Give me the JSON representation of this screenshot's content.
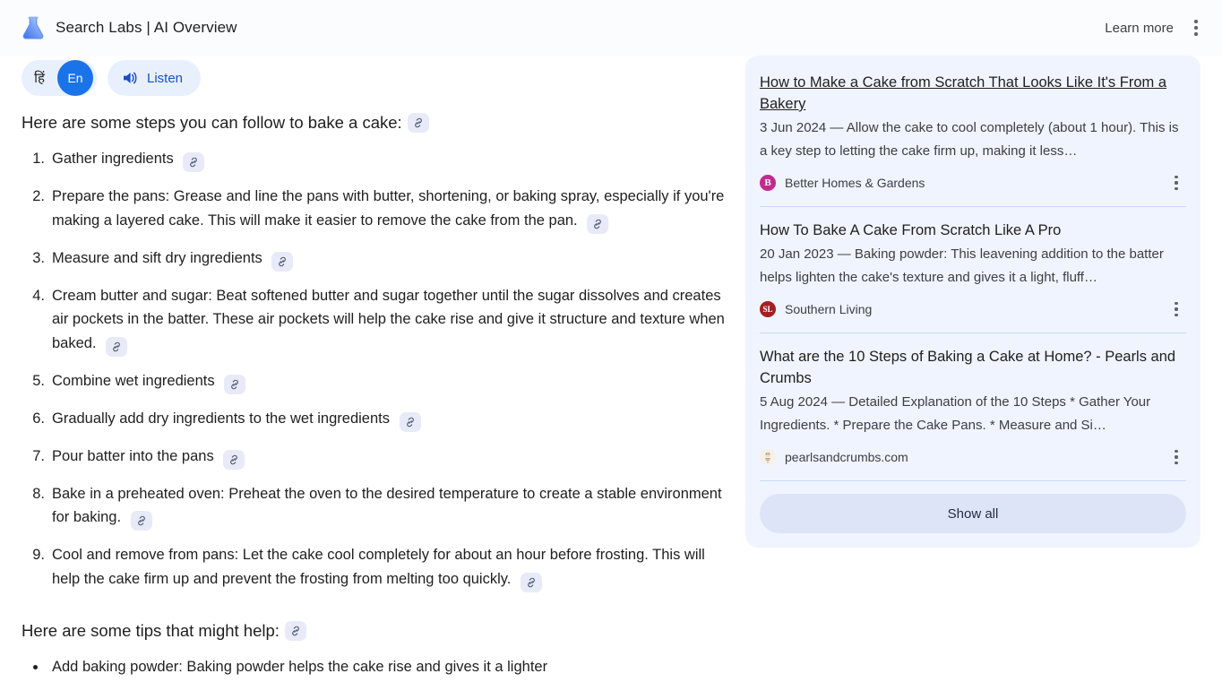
{
  "header": {
    "logo_icon": "flask-icon",
    "title": "Search Labs | AI Overview",
    "learn_more_label": "Learn more",
    "overflow_icon": "kebab-menu-icon"
  },
  "controls": {
    "lang_inactive": "हिं",
    "lang_active": "En",
    "listen_label": "Listen",
    "speaker_icon": "speaker-icon"
  },
  "main": {
    "steps_heading": "Here are some steps you can follow to bake a cake:",
    "steps": [
      "Gather ingredients",
      "Prepare the pans: Grease and line the pans with butter, shortening, or baking spray, especially if you're making a layered cake. This will make it easier to remove the cake from the pan.",
      "Measure and sift dry ingredients",
      "Cream butter and sugar: Beat softened butter and sugar together until the sugar dissolves and creates air pockets in the batter. These air pockets will help the cake rise and give it structure and texture when baked.",
      "Combine wet ingredients",
      "Gradually add dry ingredients to the wet ingredients",
      "Pour batter into the pans",
      "Bake in a preheated oven: Preheat the oven to the desired temperature to create a stable environment for baking.",
      "Cool and remove from pans: Let the cake cool completely for about an hour before frosting. This will help the cake firm up and prevent the frosting from melting too quickly."
    ],
    "tips_heading": "Here are some tips that might help:",
    "tips": [
      "Add baking powder: Baking powder helps the cake rise and gives it a lighter"
    ],
    "link_chip_icon": "link-icon"
  },
  "sources": {
    "items": [
      {
        "title": "How to Make a Cake from Scratch That Looks Like It's From a Bakery",
        "snippet": "3 Jun 2024 — Allow the cake to cool completely (about 1 hour). This is a key step to letting the cake firm up, making it less…",
        "site": "Better Homes & Gardens",
        "favicon_letter": "B",
        "favicon_color": "#c42a8e"
      },
      {
        "title": "How To Bake A Cake From Scratch Like A Pro",
        "snippet": "20 Jan 2023 — Baking powder: This leavening addition to the batter helps lighten the cake's texture and gives it a light, fluff…",
        "site": "Southern Living",
        "favicon_letter": "SL",
        "favicon_color": "#a41f23"
      },
      {
        "title": "What are the 10 Steps of Baking a Cake at Home? - Pearls and Crumbs",
        "snippet": "5 Aug 2024 — Detailed Explanation of the 10 Steps * Gather Your Ingredients. * Prepare the Cake Pans. * Measure and Si…",
        "site": "pearlsandcrumbs.com",
        "favicon_letter": "",
        "favicon_color": "#f6efe6"
      }
    ],
    "show_all_label": "Show all",
    "overflow_icon": "kebab-menu-icon"
  },
  "colors": {
    "accent_blue": "#1a73e8",
    "chip_bg": "#e8f0fe",
    "card_bg": "#f0f4fe",
    "divider": "#c7dafb",
    "button_bg": "#dde4f7"
  }
}
